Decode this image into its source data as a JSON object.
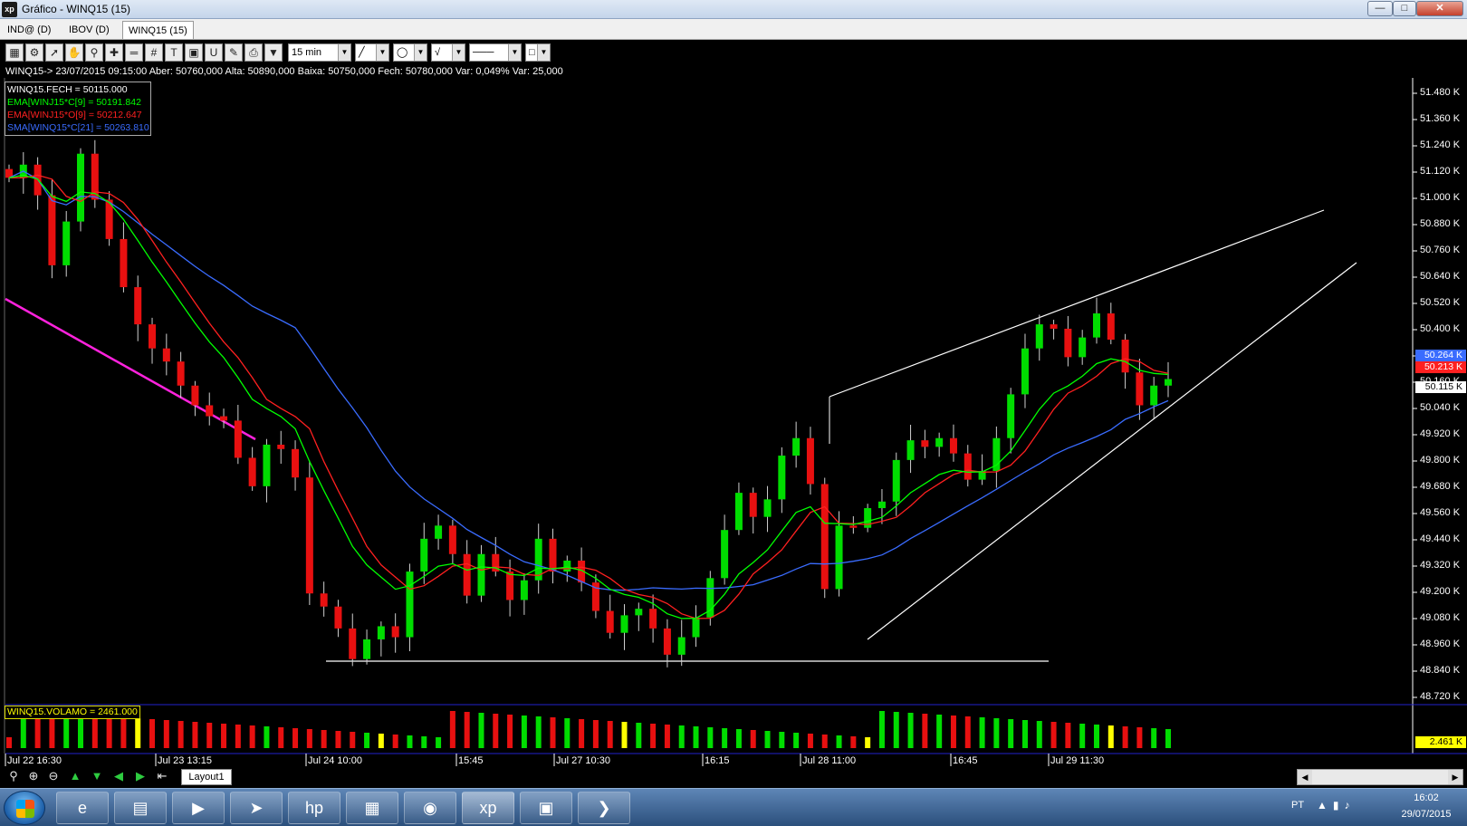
{
  "window": {
    "title": "Gráfico - WINQ15 (15)",
    "icon": "xp"
  },
  "tabs": [
    {
      "label": "IND@ (D)"
    },
    {
      "label": "IBOV (D)"
    },
    {
      "label": "WINQ15 (15)"
    }
  ],
  "toolbar": {
    "period": "15 min"
  },
  "info_line": "WINQ15-> 23/07/2015 09:15:00 Aber: 50760,000 Alta: 50890,000 Baixa: 50750,000 Fech: 50780,000 Var: 0,049% Var: 25,000",
  "legend": [
    {
      "text": "WINQ15.FECH = 50115.000",
      "color": "#ffffff"
    },
    {
      "text": "EMA[WINJ15*C[9] = 50191.842",
      "color": "#00ff00"
    },
    {
      "text": "EMA[WINJ15*O[9] = 50212.647",
      "color": "#ff2020"
    },
    {
      "text": "SMA[WINQ15*C[21] = 50263.810",
      "color": "#3a6cff"
    }
  ],
  "volume_legend": "WINQ15.VOLAMO = 2461.000",
  "price_ticks": [
    "51.480 K",
    "51.360 K",
    "51.240 K",
    "51.120 K",
    "51.000 K",
    "50.880 K",
    "50.760 K",
    "50.640 K",
    "50.520 K",
    "50.400 K",
    "50.280 K",
    "50.160 K",
    "50.040 K",
    "49.920 K",
    "49.800 K",
    "49.680 K",
    "49.560 K",
    "49.440 K",
    "49.320 K",
    "49.200 K",
    "49.080 K",
    "48.960 K",
    "48.840 K",
    "48.720 K"
  ],
  "price_badges": [
    {
      "text": "50.264 K",
      "bg": "#3a6cff",
      "fg": "#ffffff"
    },
    {
      "text": "50.213 K",
      "bg": "#ff2020",
      "fg": "#ffffff"
    },
    {
      "text": "50.115 K",
      "bg": "#ffffff",
      "fg": "#000000"
    }
  ],
  "volume_badge": "2.461 K",
  "time_ticks": [
    "Jul 22 16:30",
    "Jul 23 13:15",
    "Jul 24 10:00",
    "15:45",
    "Jul 27 10:30",
    "16:15",
    "Jul 28 11:00",
    "16:45",
    "Jul 29 11:30"
  ],
  "layout_tab": "Layout1",
  "tray": {
    "lang": "PT",
    "time": "16:02",
    "date": "29/07/2015"
  },
  "chart_data": {
    "type": "candlestick",
    "symbol": "WINQ15",
    "interval": "15 min",
    "ylim": [
      48700,
      51540
    ],
    "close_series": [
      51100,
      51160,
      51020,
      50700,
      50900,
      51210,
      51000,
      50820,
      50600,
      50430,
      50320,
      50260,
      50150,
      50060,
      50010,
      49990,
      49820,
      49690,
      49880,
      49860,
      49730,
      49200,
      49140,
      49040,
      48900,
      48990,
      49050,
      49000,
      49300,
      49450,
      49510,
      49380,
      49190,
      49380,
      49300,
      49170,
      49260,
      49450,
      49300,
      49350,
      49250,
      49120,
      49020,
      49100,
      49130,
      49040,
      48920,
      49000,
      49090,
      49270,
      49490,
      49660,
      49550,
      49630,
      49830,
      49910,
      49700,
      49220,
      49510,
      49500,
      49590,
      49620,
      49810,
      49900,
      49870,
      49910,
      49840,
      49720,
      49760,
      49910,
      50110,
      50320,
      50430,
      50410,
      50280,
      50370,
      50480,
      50360,
      50210,
      50060,
      50150,
      50180
    ]
  }
}
